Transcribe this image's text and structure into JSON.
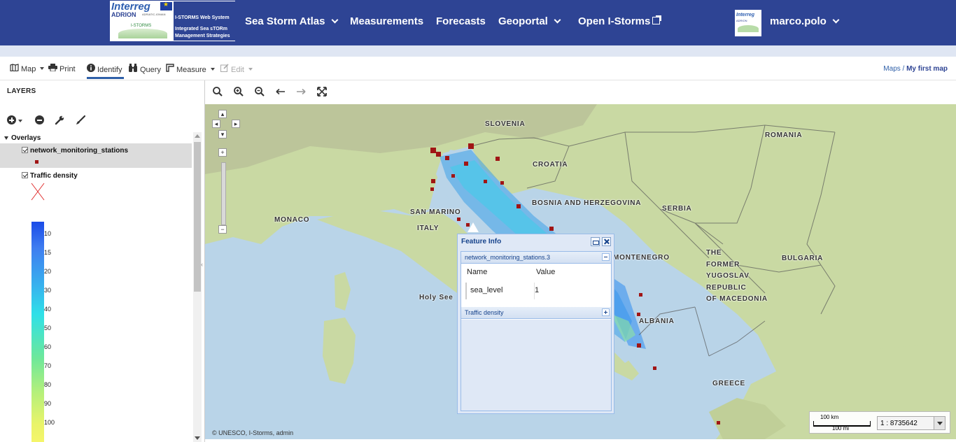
{
  "nav": {
    "logo": {
      "interreg": "Interreg",
      "adrion": "ADRION",
      "subtitle": "ADRIATIC-IONIAN",
      "istorms": "I-STORMS",
      "web_system": "I-STORMS Web System",
      "tagline": "Integrated Sea sTORm Management Strategies"
    },
    "items": [
      {
        "label": "Sea Storm Atlas",
        "dropdown": true
      },
      {
        "label": "Measurements",
        "dropdown": false
      },
      {
        "label": "Forecasts",
        "dropdown": false
      },
      {
        "label": "Geoportal",
        "dropdown": true
      },
      {
        "label": "Open I-Storms",
        "external": true
      }
    ],
    "user": {
      "name": "marco.polo",
      "logo_text": "Interreg",
      "logo_sub": "ADRION"
    }
  },
  "toolbar": {
    "map": "Map",
    "print": "Print",
    "identify": "Identify",
    "query": "Query",
    "measure": "Measure",
    "edit": "Edit",
    "breadcrumb_root": "Maps",
    "breadcrumb_sep": "/",
    "breadcrumb_current": "My first map"
  },
  "layers": {
    "title": "LAYERS",
    "group": "Overlays",
    "items": [
      {
        "name": "network_monitoring_stations",
        "checked": true,
        "symbol_color": "#a01515"
      },
      {
        "name": "Traffic density",
        "checked": true,
        "symbol_color": "#e03030"
      }
    ],
    "legend_labels": [
      "10",
      "15",
      "20",
      "30",
      "40",
      "50",
      "60",
      "70",
      "80",
      "90",
      "100"
    ],
    "legend_colors": [
      "#1b4be8",
      "#37b5ee",
      "#2fe0e8",
      "#6ee89a",
      "#f5f56a"
    ]
  },
  "map": {
    "countries": [
      {
        "label": "SLOVENIA"
      },
      {
        "label": "ROMANIA"
      },
      {
        "label": "CROATIA"
      },
      {
        "label": "BOSNIA AND HERZEGOVINA"
      },
      {
        "label": "SERBIA"
      },
      {
        "label": "SAN MARINO"
      },
      {
        "label": "MONACO"
      },
      {
        "label": "ITALY"
      },
      {
        "label": "MONTENEGRO"
      },
      {
        "label": "BULGARIA"
      },
      {
        "label": "THE"
      },
      {
        "label": "FORMER"
      },
      {
        "label": "YUGOSLAV"
      },
      {
        "label": "REPUBLIC"
      },
      {
        "label": "OF MACEDONIA"
      },
      {
        "label": "Holy See"
      },
      {
        "label": "ALBANIA"
      },
      {
        "label": "GREECE"
      }
    ],
    "attribution": "© UNESCO, I-Storms, admin",
    "scale_km": "100 km",
    "scale_mi": "100 mi",
    "scale_value": "1 : 8735642",
    "water_color": "#b9d4e8",
    "land_color": "#c9d9a3"
  },
  "feature_info": {
    "title": "Feature Info",
    "section1": "network_monitoring_stations.3",
    "col_name": "Name",
    "col_value": "Value",
    "rows": [
      {
        "name": "sea_level",
        "value": "1"
      }
    ],
    "section2": "Traffic density"
  }
}
